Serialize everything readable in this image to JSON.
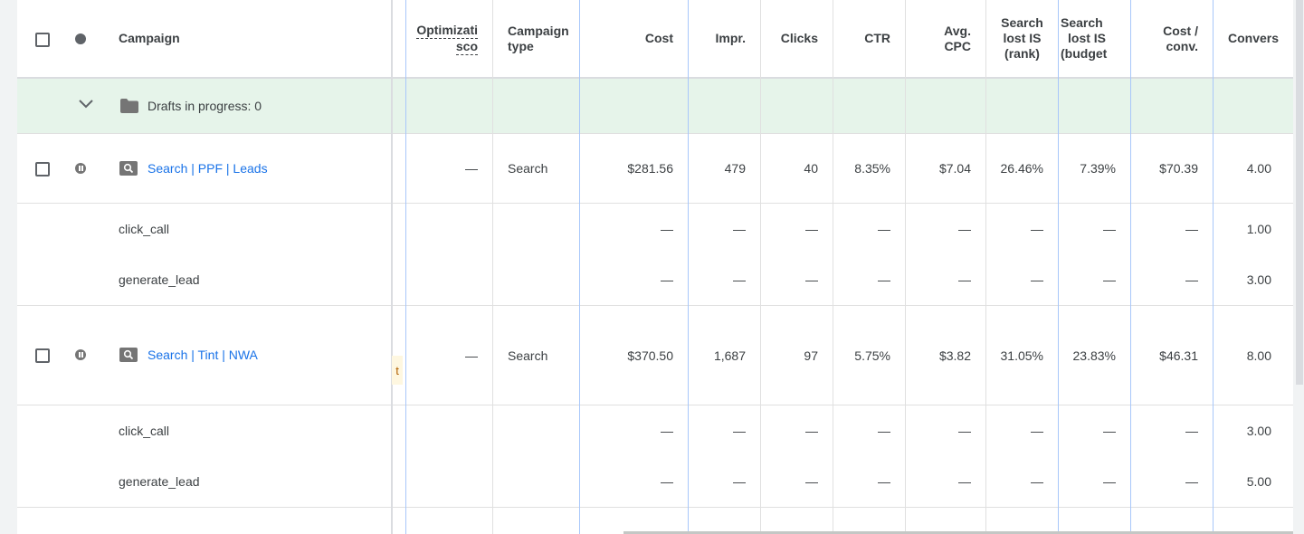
{
  "colors": {
    "link": "#1a73e8",
    "draft_row_bg": "#e6f4ea",
    "divider": "#e0e0e0",
    "frozen_divider": "#a8c7fa",
    "warning_chip": "#fef7e0"
  },
  "header": {
    "campaign": "Campaign",
    "optimization_line1": "Optimizati",
    "optimization_line2": "sco",
    "campaign_type_line1": "Campaign",
    "campaign_type_line2": "type",
    "cost": "Cost",
    "impr": "Impr.",
    "clicks": "Clicks",
    "ctr": "CTR",
    "avg_cpc_line1": "Avg.",
    "avg_cpc_line2": "CPC",
    "search_lost_rank_line1": "Search",
    "search_lost_rank_line2": "lost IS",
    "search_lost_rank_line3": "(rank)",
    "search_lost_budget_line1": "Search",
    "search_lost_budget_line2": "lost IS",
    "search_lost_budget_line3": "(budget",
    "cost_conv_line1": "Cost /",
    "cost_conv_line2": "conv.",
    "conversions": "Convers"
  },
  "drafts": {
    "label": "Drafts in progress: 0"
  },
  "campaigns": [
    {
      "name": "Search | PPF | Leads",
      "optimization": "—",
      "type": "Search",
      "cost": "$281.56",
      "impr": "479",
      "clicks": "40",
      "ctr": "8.35%",
      "avg_cpc": "$7.04",
      "lost_rank": "26.46%",
      "lost_budget": "7.39%",
      "cost_conv": "$70.39",
      "conversions": "4.00",
      "actions": [
        {
          "name": "click_call",
          "cost": "—",
          "impr": "—",
          "clicks": "—",
          "ctr": "—",
          "avg_cpc": "—",
          "lost_rank": "—",
          "lost_budget": "—",
          "cost_conv": "—",
          "conversions": "1.00"
        },
        {
          "name": "generate_lead",
          "cost": "—",
          "impr": "—",
          "clicks": "—",
          "ctr": "—",
          "avg_cpc": "—",
          "lost_rank": "—",
          "lost_budget": "—",
          "cost_conv": "—",
          "conversions": "3.00"
        }
      ]
    },
    {
      "name": "Search | Tint | NWA",
      "warning_chip": "t",
      "optimization": "—",
      "type": "Search",
      "cost": "$370.50",
      "impr": "1,687",
      "clicks": "97",
      "ctr": "5.75%",
      "avg_cpc": "$3.82",
      "lost_rank": "31.05%",
      "lost_budget": "23.83%",
      "cost_conv": "$46.31",
      "conversions": "8.00",
      "actions": [
        {
          "name": "click_call",
          "cost": "—",
          "impr": "—",
          "clicks": "—",
          "ctr": "—",
          "avg_cpc": "—",
          "lost_rank": "—",
          "lost_budget": "—",
          "cost_conv": "—",
          "conversions": "3.00"
        },
        {
          "name": "generate_lead",
          "cost": "—",
          "impr": "—",
          "clicks": "—",
          "ctr": "—",
          "avg_cpc": "—",
          "lost_rank": "—",
          "lost_budget": "—",
          "cost_conv": "—",
          "conversions": "5.00"
        }
      ]
    }
  ]
}
